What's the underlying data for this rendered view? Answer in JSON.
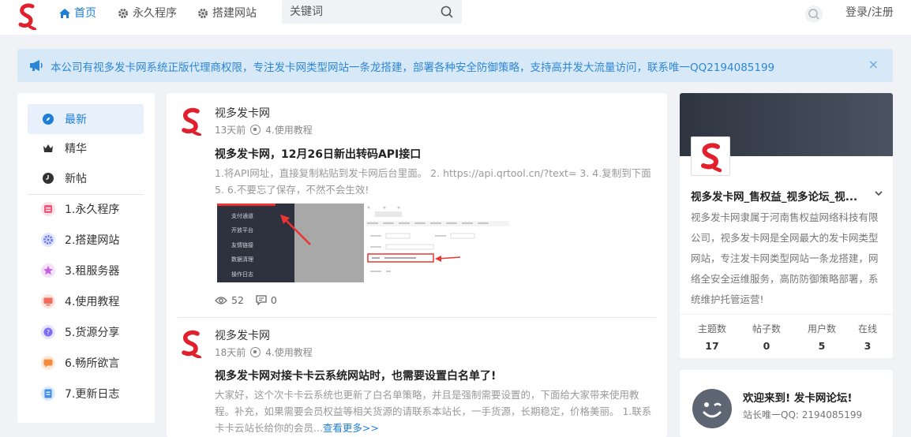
{
  "nav": {
    "home": "首页",
    "permanent_program": "永久程序",
    "build_site": "搭建网站",
    "search_placeholder": "关键词",
    "login": "登录/注册"
  },
  "notice": {
    "text": "本公司有视多发卡网系统正版代理商权限，专注发卡网类型网站一条龙搭建，部署各种安全防御策略，支持高并发大流量访问，联系唯一QQ2194085199",
    "close": "×"
  },
  "left_nav": {
    "items": [
      {
        "label": "最新",
        "icon": "compass-icon",
        "color": "#1e7fd8"
      },
      {
        "label": "精华",
        "icon": "crown-icon",
        "color": "#333333"
      },
      {
        "label": "新帖",
        "icon": "clock-icon",
        "color": "#333333"
      },
      {
        "label": "1.永久程序",
        "icon": "calendar-icon",
        "color": "#f0577a"
      },
      {
        "label": "2.搭建网站",
        "icon": "gear-icon",
        "color": "#6c7cf0"
      },
      {
        "label": "3.租服务器",
        "icon": "star-icon",
        "color": "#c85ee0"
      },
      {
        "label": "4.使用教程",
        "icon": "monitor-icon",
        "color": "#f36b5b"
      },
      {
        "label": "5.货源分享",
        "icon": "question-icon",
        "color": "#7b6cf0"
      },
      {
        "label": "6.畅所欲言",
        "icon": "chat-icon",
        "color": "#f58a3d"
      },
      {
        "label": "7.更新日志",
        "icon": "document-icon",
        "color": "#3f8fe8"
      }
    ]
  },
  "posts": [
    {
      "author": "视多发卡网",
      "time": "13天前",
      "category": "4.使用教程",
      "title": "视多发卡网，12月26日新出转码API接口",
      "excerpt": "1.将API网址，直接复制粘贴到发卡网后台里面。 2.  https://api.qrtool.cn/?text= 3. 4.复制到下面 5. 6.不要忘了保存，不然不会生效!",
      "thumb_menu": [
        "支付通道",
        "开放平台",
        "友情链接",
        "数据清理",
        "操作日志"
      ],
      "views": "52",
      "comments": "0"
    },
    {
      "author": "视多发卡网",
      "time": "18天前",
      "category": "4.使用教程",
      "title": "视多发卡网对接卡卡云系统网站时，也需要设置白名单了!",
      "excerpt": "大家好，这个次卡卡云系统也更新了白名单策略，并且是强制需要设置的，下面给大家带来使用教程。补充，如果需要会员权益等相关货源的请联系本站长，一手货源，长期稳定，价格美丽。 1.联系卡卡云站长给你的会员...",
      "more": "查看更多>>"
    }
  ],
  "profile": {
    "name": "视多发卡网_售权益_视多论坛_视...",
    "description": "视多发卡网隶属于河南售权益网络科技有限公司，视多发卡网是全网最大的发卡网类型网站，专注发卡网类型网站一条龙搭建，网络全安全运维服务，高防防御策略部署，系统维护托管运营!",
    "stats": [
      {
        "label": "主题数",
        "value": "17"
      },
      {
        "label": "帖子数",
        "value": "0"
      },
      {
        "label": "用户数",
        "value": "5"
      },
      {
        "label": "在线",
        "value": "3"
      }
    ]
  },
  "welcome": {
    "title": "欢迎来到! 发卡网论坛!",
    "subtitle": "站长唯一QQ: 2194085199"
  },
  "colors": {
    "accent": "#1e7fd8",
    "brand_red": "#e0202c",
    "notice_bg": "#d7e9f7"
  }
}
